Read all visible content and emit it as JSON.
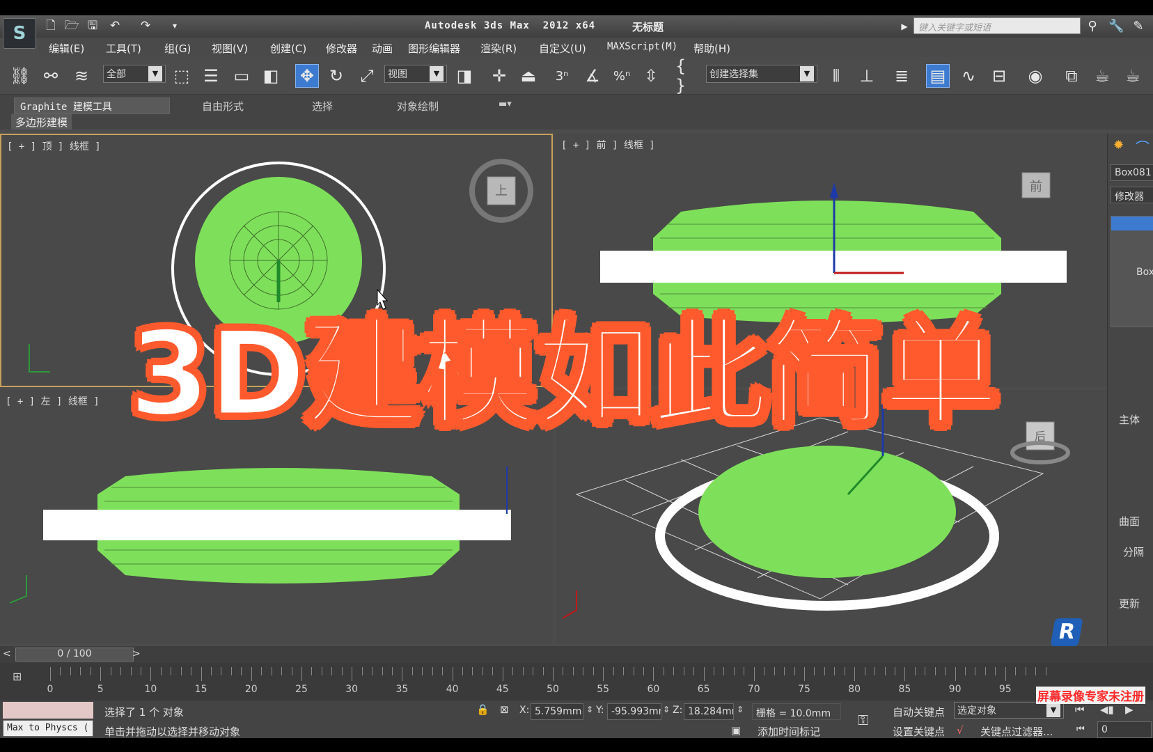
{
  "titlebar": {
    "window_title": "Autodesk 3ds Max  2012 x64",
    "doc_title": "无标题",
    "search_placeholder": "键入关键字或短语"
  },
  "menu": [
    "编辑(E)",
    "工具(T)",
    "组(G)",
    "视图(V)",
    "创建(C)",
    "修改器",
    "动画",
    "图形编辑器",
    "渲染(R)",
    "自定义(U)",
    "MAXScript(M)",
    "帮助(H)"
  ],
  "toolbar": {
    "selection_filter": "全部",
    "ref_coord": "视图",
    "named_selection": "创建选择集",
    "snap_3": "3",
    "percent": "%"
  },
  "ribbon": {
    "tabs": [
      "Graphite 建模工具",
      "自由形式",
      "选择",
      "对象绘制"
    ],
    "sub_tab": "多边形建模"
  },
  "viewports": {
    "top": "[ + ] 顶 ] 线框 ]",
    "front": "[ + ] 前 ] 线框 ]",
    "left": "[ + ] 左 ] 线框 ]",
    "viewcube_top": "上",
    "viewcube_front": "前",
    "viewcube_persp": "后"
  },
  "command_panel": {
    "object_name": "Box081",
    "modifier_list": "修改器",
    "stack_item": "Box",
    "section_main": "主体",
    "section_surface": "曲面",
    "sep_label": "分隔",
    "update_label": "更新"
  },
  "timeline": {
    "frame": "0 / 100",
    "ticks": [
      "0",
      "5",
      "10",
      "15",
      "20",
      "25",
      "30",
      "35",
      "40",
      "45",
      "50",
      "55",
      "60",
      "65",
      "70",
      "75",
      "80",
      "85",
      "90",
      "95"
    ]
  },
  "status": {
    "maxscript_listener": "Max to Physcs (",
    "selected": "选择了 1 个 对象",
    "prompt": "单击并拖动以选择并移动对象",
    "x_label": "X:",
    "x": "5.759mm",
    "y_label": "Y:",
    "y": "-95.993mm",
    "z_label": "Z:",
    "z": "18.284mm",
    "grid": "栅格 = 10.0mm",
    "add_time_tag": "添加时间标记",
    "auto_key": "自动关键点",
    "set_key": "设置关键点",
    "key_mode": "选定对象",
    "key_filters": "关键点过滤器...",
    "frame_field": "0"
  },
  "overlay": {
    "headline": "3D建模如此简单",
    "watermark": "屏幕录像专家未注册"
  },
  "colors": {
    "model_green": "#7ee05a",
    "headline_stroke": "#ff5a2d",
    "active_tool": "#3d7bd0"
  }
}
